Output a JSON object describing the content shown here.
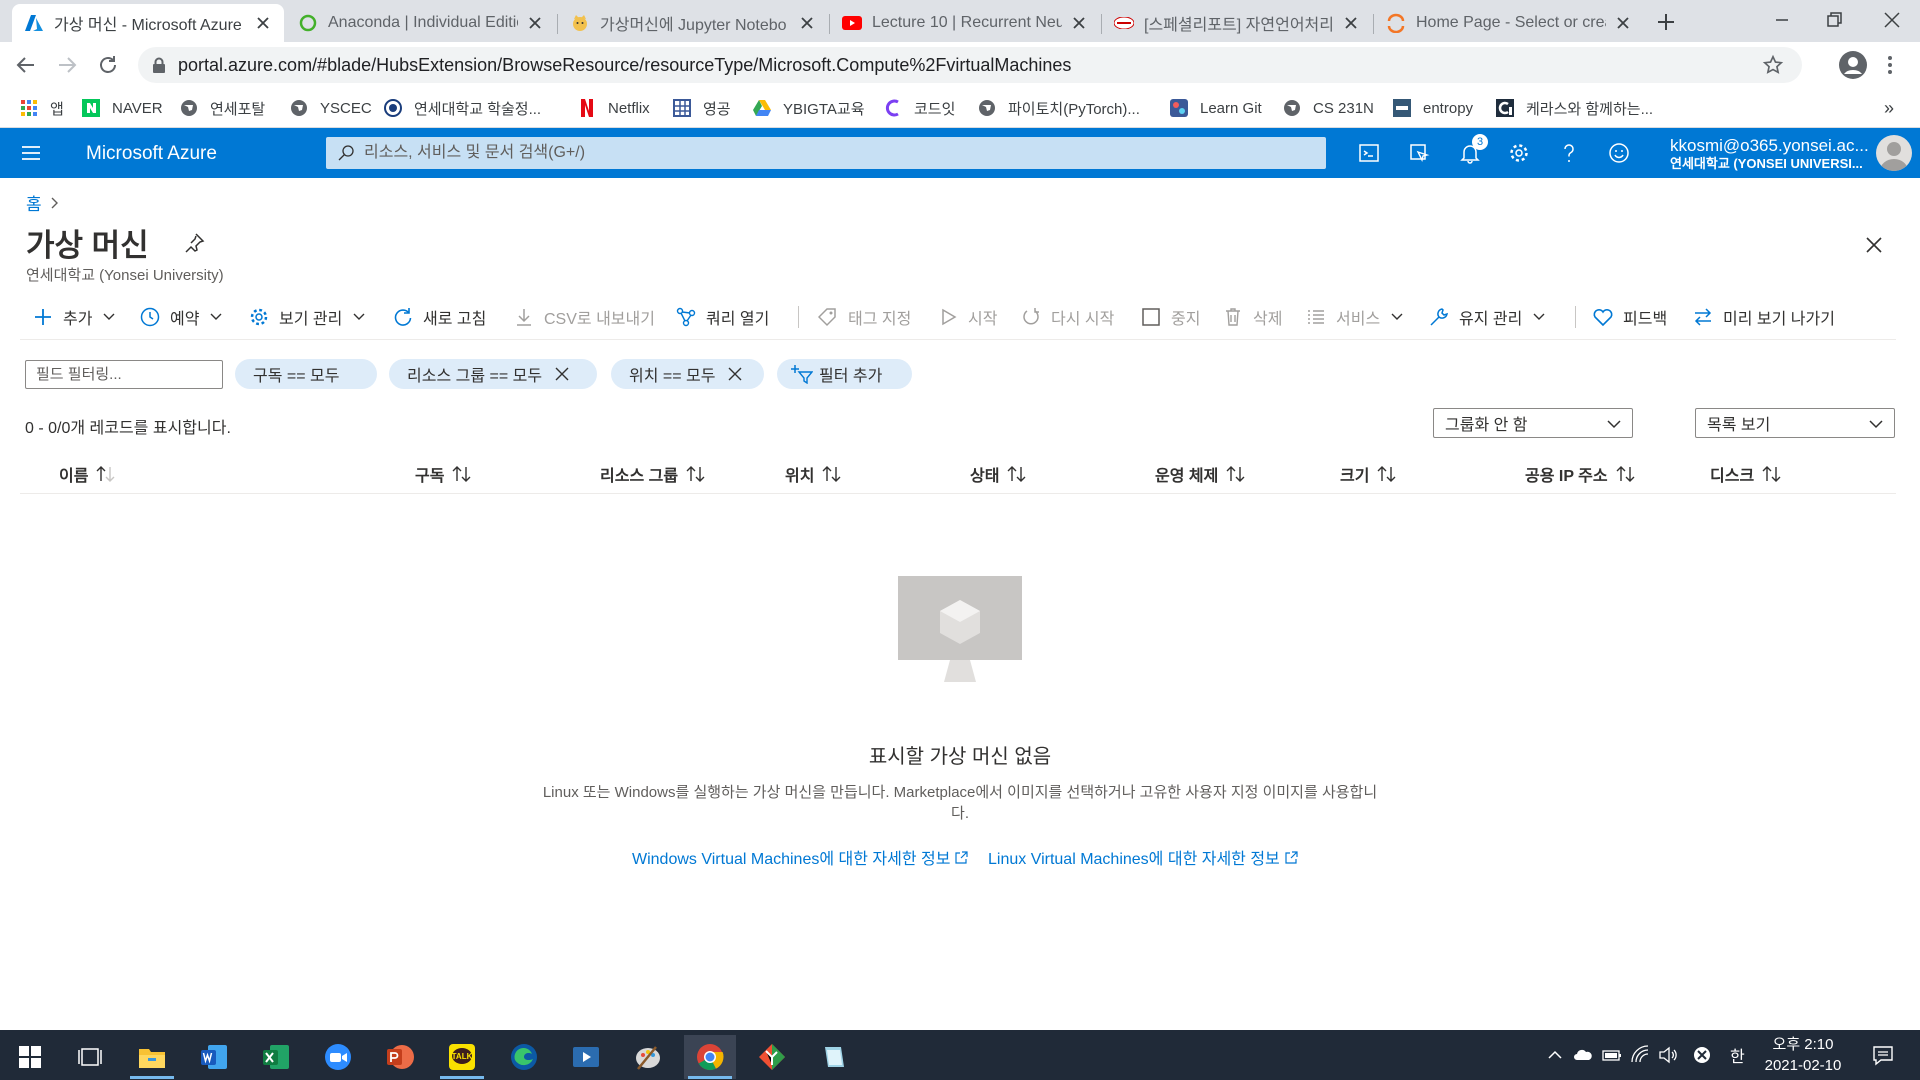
{
  "browser": {
    "tabs": [
      {
        "title": "가상 머신 - Microsoft Azure",
        "active": true
      },
      {
        "title": "Anaconda | Individual Editio"
      },
      {
        "title": "가상머신에 Jupyter Notebo"
      },
      {
        "title": "Lecture 10 | Recurrent Neur"
      },
      {
        "title": "[스페셜리포트] 자연언어처리"
      },
      {
        "title": "Home Page - Select or crea"
      }
    ],
    "url": "portal.azure.com/#blade/HubsExtension/BrowseResource/resourceType/Microsoft.Compute%2FvirtualMachines",
    "bookmarks": [
      "앱",
      "NAVER",
      "연세포탈",
      "YSCEC",
      "연세대학교 학술정...",
      "Netflix",
      "영공",
      "YBIGTA교육",
      "코드잇",
      "파이토치(PyTorch)...",
      "Learn Git",
      "CS 231N",
      "entropy",
      "케라스와 함께하는..."
    ],
    "more_bookmarks": "»"
  },
  "azure": {
    "brand": "Microsoft Azure",
    "search_placeholder": "리소스, 서비스 및 문서 검색(G+/)",
    "notification_count": "3",
    "account_email": "kkosmi@o365.yonsei.ac...",
    "account_org": "연세대학교 (YONSEI UNIVERSI..."
  },
  "page": {
    "breadcrumb_home": "홈",
    "title": "가상 머신",
    "subtitle": "연세대학교 (Yonsei University)"
  },
  "commands": {
    "add": "추가",
    "schedule": "예약",
    "manage_view": "보기 관리",
    "refresh": "새로 고침",
    "export_csv": "CSV로 내보내기",
    "open_query": "쿼리 열기",
    "assign_tags": "태그 지정",
    "start": "시작",
    "restart": "다시 시작",
    "stop": "중지",
    "delete": "삭제",
    "services": "서비스",
    "maintenance": "유지 관리",
    "feedback": "피드백",
    "leave_preview": "미리 보기 나가기"
  },
  "filters": {
    "field_placeholder": "필드 필터링...",
    "subscription": "구독 == 모두",
    "resource_group": "리소스 그룹 == 모두",
    "location": "위치 == 모두",
    "add_filter": "필터 추가"
  },
  "records_info": "0 - 0/0개 레코드를 표시합니다.",
  "grouping": "그룹화 안 함",
  "view_mode": "목록 보기",
  "columns": [
    "이름",
    "구독",
    "리소스 그룹",
    "위치",
    "상태",
    "운영 체제",
    "크기",
    "공용 IP 주소",
    "디스크"
  ],
  "empty_state": {
    "title": "표시할 가상 머신 없음",
    "description": "Linux 또는 Windows를 실행하는 가상 머신을 만듭니다. Marketplace에서 이미지를 선택하거나 고유한 사용자 지정 이미지를 사용합니다.",
    "link_windows": "Windows Virtual Machines에 대한 자세한 정보",
    "link_linux": "Linux Virtual Machines에 대한 자세한 정보"
  },
  "taskbar": {
    "ime": "한",
    "time": "오후 2:10",
    "date": "2021-02-10"
  },
  "colors": {
    "azure_blue": "#0078d4",
    "search_bg": "#c7e0f4",
    "pill_bg": "#deecf9",
    "taskbar": "#202a38"
  }
}
